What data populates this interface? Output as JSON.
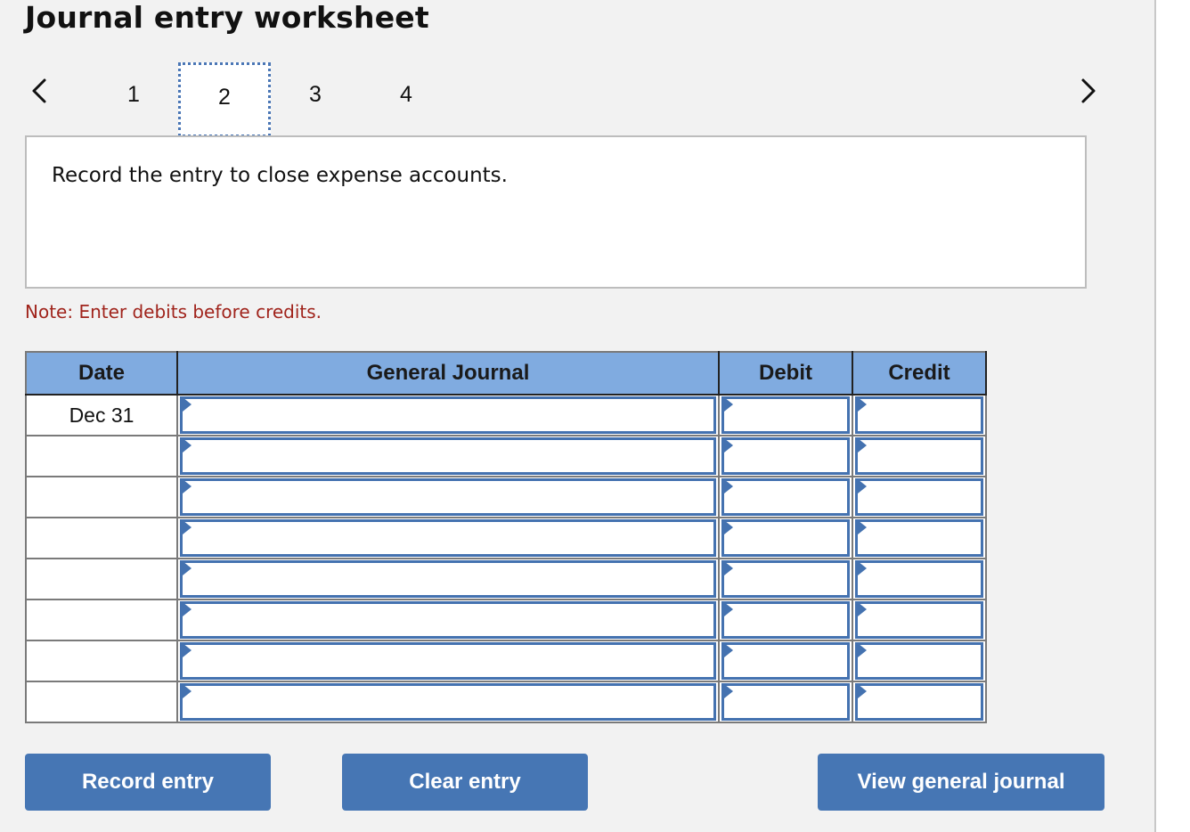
{
  "page": {
    "title": "Journal entry worksheet"
  },
  "navigation": {
    "prev_icon": "chevron-left-icon",
    "next_icon": "chevron-right-icon",
    "tabs": [
      {
        "label": "1",
        "active": false
      },
      {
        "label": "2",
        "active": true
      },
      {
        "label": "3",
        "active": false
      },
      {
        "label": "4",
        "active": false
      }
    ]
  },
  "prompt": {
    "text": "Record the entry to close expense accounts."
  },
  "note": "Note: Enter debits before credits.",
  "table": {
    "headers": [
      "Date",
      "General Journal",
      "Debit",
      "Credit"
    ],
    "rows": [
      {
        "date": "Dec 31",
        "account": "",
        "debit": "",
        "credit": ""
      },
      {
        "date": "",
        "account": "",
        "debit": "",
        "credit": ""
      },
      {
        "date": "",
        "account": "",
        "debit": "",
        "credit": ""
      },
      {
        "date": "",
        "account": "",
        "debit": "",
        "credit": ""
      },
      {
        "date": "",
        "account": "",
        "debit": "",
        "credit": ""
      },
      {
        "date": "",
        "account": "",
        "debit": "",
        "credit": ""
      },
      {
        "date": "",
        "account": "",
        "debit": "",
        "credit": ""
      },
      {
        "date": "",
        "account": "",
        "debit": "",
        "credit": ""
      }
    ]
  },
  "buttons": {
    "record": "Record entry",
    "clear": "Clear entry",
    "view": "View general journal"
  },
  "colors": {
    "accent": "#4676b4",
    "header_bg": "#80abe0",
    "note": "#a0241c"
  }
}
